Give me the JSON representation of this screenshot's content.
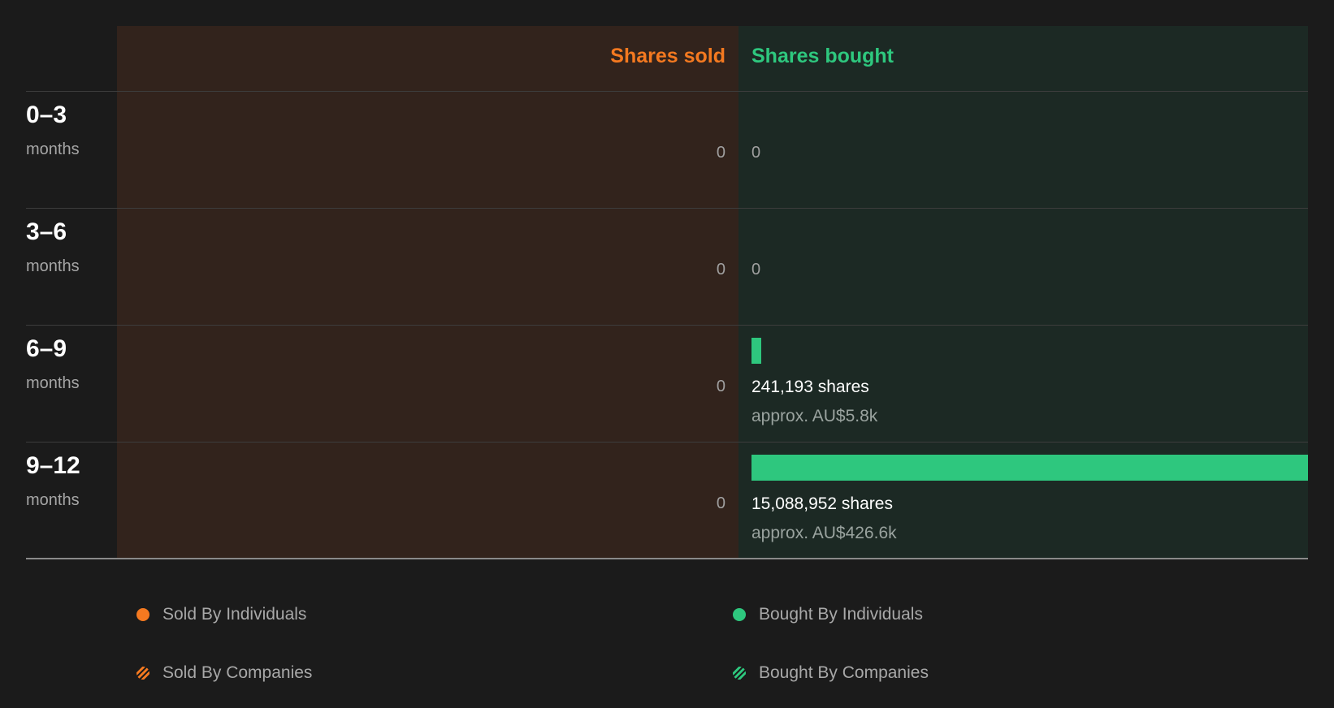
{
  "colors": {
    "background": "#1b1b1b",
    "sold_panel": "#32231c",
    "bought_panel": "#1c2924",
    "sold_accent": "#f47920",
    "bought_accent": "#2ec77e"
  },
  "chart_data": {
    "type": "bar",
    "orientation": "horizontal-diverging",
    "headers": {
      "sold": "Shares sold",
      "bought": "Shares bought"
    },
    "unit_label": "months",
    "categories": [
      "0–3",
      "3–6",
      "6–9",
      "9–12"
    ],
    "series": [
      {
        "name": "Shares sold",
        "values": [
          0,
          0,
          0,
          0
        ],
        "labels": [
          "0",
          "0",
          "0",
          "0"
        ]
      },
      {
        "name": "Shares bought",
        "values": [
          0,
          0,
          241193,
          15088952
        ],
        "labels": [
          "0",
          "0",
          "241,193 shares",
          "15,088,952 shares"
        ],
        "approx": [
          "",
          "",
          "approx. AU$5.8k",
          "approx. AU$426.6k"
        ]
      }
    ],
    "legend": [
      {
        "label": "Sold By Individuals",
        "style": "solid",
        "color": "#f47920"
      },
      {
        "label": "Bought By Individuals",
        "style": "solid",
        "color": "#2ec77e"
      },
      {
        "label": "Sold By Companies",
        "style": "hatched",
        "color": "#f47920"
      },
      {
        "label": "Bought By Companies",
        "style": "hatched",
        "color": "#2ec77e"
      }
    ],
    "legend_placement": "bottom",
    "grid": false
  }
}
